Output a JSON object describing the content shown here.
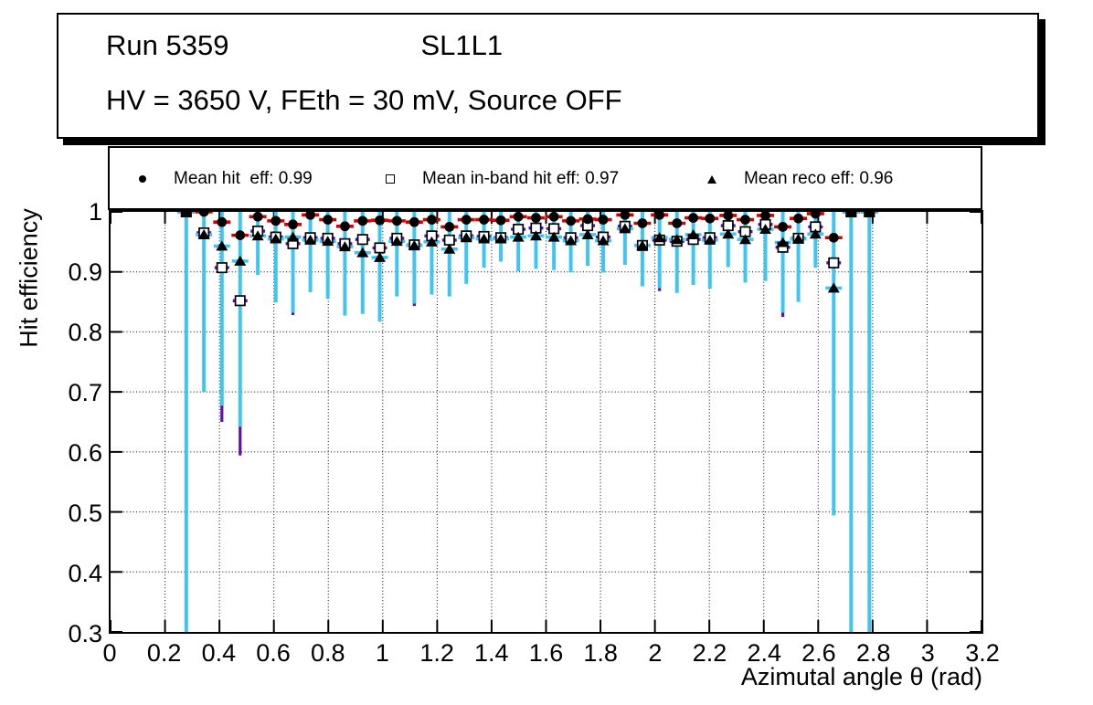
{
  "title_box": {
    "line1_left": "Run 5359",
    "line1_right": "SL1L1",
    "line2": "HV = 3650 V, FEth = 30 mV, Source OFF"
  },
  "legend": {
    "entries": [
      {
        "marker": "filled-circle",
        "label": "Mean hit  eff: 0.99"
      },
      {
        "marker": "open-square",
        "label": "Mean in-band hit eff: 0.97"
      },
      {
        "marker": "filled-triangle",
        "label": "Mean reco eff: 0.96"
      }
    ]
  },
  "chart_data": {
    "type": "scatter",
    "xlabel": "Azimutal angle θ (rad)",
    "ylabel": "Hit efficiency",
    "xlim": [
      0,
      3.2
    ],
    "ylim": [
      0.3,
      1.0
    ],
    "grid": "dotted-both",
    "legend_position": "top-band",
    "x_tick_values": [
      0,
      0.2,
      0.4,
      0.6,
      0.8,
      1,
      1.2,
      1.4,
      1.6,
      1.8,
      2,
      2.2,
      2.4,
      2.6,
      2.8,
      3,
      3.2
    ],
    "x_tick_labels": [
      "0",
      "0.2",
      "0.4",
      "0.6",
      "0.8",
      "1",
      "1.2",
      "1.4",
      "1.6",
      "1.8",
      "2",
      "2.2",
      "2.4",
      "2.6",
      "2.8",
      "3",
      "3.2"
    ],
    "y_tick_values": [
      0.3,
      0.4,
      0.5,
      0.6,
      0.7,
      0.8,
      0.9,
      1
    ],
    "y_tick_labels": [
      "0.3",
      "0.4",
      "0.5",
      "0.6",
      "0.7",
      "0.8",
      "0.9",
      "1"
    ],
    "colors": {
      "marker": "#000000",
      "hit_xerr": "#d40000",
      "inband_err": "#5c10b2",
      "reco_err": "#3fc6f0"
    },
    "series": [
      {
        "name": "Mean hit  eff: 0.99",
        "mean": 0.99,
        "marker": "filled-circle",
        "value_key": "hit"
      },
      {
        "name": "Mean in-band hit eff: 0.97",
        "mean": 0.97,
        "marker": "open-square",
        "value_key": "inband"
      },
      {
        "name": "Mean reco eff: 0.96",
        "mean": 0.96,
        "marker": "filled-triangle",
        "value_key": "reco"
      }
    ],
    "points": [
      {
        "x": 0.278,
        "hit": 1.0,
        "inband": 1.0,
        "reco": 1.0,
        "reco_lo": 0.3
      },
      {
        "x": 0.343,
        "hit": 1.0,
        "inband": 0.965,
        "reco": 0.962,
        "reco_lo": 0.7
      },
      {
        "x": 0.409,
        "hit": 0.983,
        "inband": 0.907,
        "reco": 0.943,
        "reco_lo": 0.677,
        "inband_lo": 0.65
      },
      {
        "x": 0.476,
        "hit": 0.961,
        "inband": 0.852,
        "reco": 0.918,
        "reco_lo": 0.642,
        "inband_lo": 0.594
      },
      {
        "x": 0.541,
        "hit": 0.992,
        "inband": 0.968,
        "reco": 0.96,
        "reco_lo": 0.895
      },
      {
        "x": 0.607,
        "hit": 0.985,
        "inband": 0.958,
        "reco": 0.955,
        "reco_lo": 0.849
      },
      {
        "x": 0.67,
        "hit": 0.979,
        "inband": 0.947,
        "reco": 0.958,
        "reco_lo": 0.832,
        "inband_lo": 0.828
      },
      {
        "x": 0.734,
        "hit": 0.995,
        "inband": 0.957,
        "reco": 0.953,
        "reco_lo": 0.866
      },
      {
        "x": 0.798,
        "hit": 0.987,
        "inband": 0.956,
        "reco": 0.951,
        "reco_lo": 0.855
      },
      {
        "x": 0.861,
        "hit": 0.976,
        "inband": 0.947,
        "reco": 0.942,
        "reco_lo": 0.827
      },
      {
        "x": 0.926,
        "hit": 0.985,
        "inband": 0.954,
        "reco": 0.932,
        "reco_lo": 0.83
      },
      {
        "x": 0.989,
        "hit": 0.986,
        "inband": 0.94,
        "reco": 0.924,
        "reco_lo": 0.817
      },
      {
        "x": 1.052,
        "hit": 0.985,
        "inband": 0.956,
        "reco": 0.951,
        "reco_lo": 0.859
      },
      {
        "x": 1.116,
        "hit": 0.983,
        "inband": 0.945,
        "reco": 0.944,
        "reco_lo": 0.847,
        "inband_lo": 0.843
      },
      {
        "x": 1.18,
        "hit": 0.987,
        "inband": 0.96,
        "reco": 0.95,
        "reco_lo": 0.862
      },
      {
        "x": 1.245,
        "hit": 0.975,
        "inband": 0.953,
        "reco": 0.938,
        "reco_lo": 0.859
      },
      {
        "x": 1.307,
        "hit": 0.987,
        "inband": 0.96,
        "reco": 0.957,
        "reco_lo": 0.88
      },
      {
        "x": 1.372,
        "hit": 0.987,
        "inband": 0.959,
        "reco": 0.955,
        "reco_lo": 0.907
      },
      {
        "x": 1.434,
        "hit": 0.986,
        "inband": 0.957,
        "reco": 0.955,
        "reco_lo": 0.917
      },
      {
        "x": 1.498,
        "hit": 0.992,
        "inband": 0.971,
        "reco": 0.958,
        "reco_lo": 0.901
      },
      {
        "x": 1.563,
        "hit": 0.99,
        "inband": 0.973,
        "reco": 0.96,
        "reco_lo": 0.905
      },
      {
        "x": 1.629,
        "hit": 0.992,
        "inband": 0.972,
        "reco": 0.958,
        "reco_lo": 0.903
      },
      {
        "x": 1.691,
        "hit": 0.985,
        "inband": 0.957,
        "reco": 0.952,
        "reco_lo": 0.899
      },
      {
        "x": 1.753,
        "hit": 0.988,
        "inband": 0.977,
        "reco": 0.962,
        "reco_lo": 0.91
      },
      {
        "x": 1.81,
        "hit": 0.987,
        "inband": 0.958,
        "reco": 0.952,
        "reco_lo": 0.899
      },
      {
        "x": 1.89,
        "hit": 0.995,
        "inband": 0.976,
        "reco": 0.972,
        "reco_lo": 0.912
      },
      {
        "x": 1.954,
        "hit": 0.981,
        "inband": 0.944,
        "reco": 0.944,
        "reco_lo": 0.876
      },
      {
        "x": 2.017,
        "hit": 0.995,
        "inband": 0.953,
        "reco": 0.957,
        "reco_lo": 0.873,
        "inband_lo": 0.868
      },
      {
        "x": 2.081,
        "hit": 0.981,
        "inband": 0.951,
        "reco": 0.954,
        "reco_lo": 0.865
      },
      {
        "x": 2.141,
        "hit": 0.99,
        "inband": 0.954,
        "reco": 0.962,
        "reco_lo": 0.878
      },
      {
        "x": 2.202,
        "hit": 0.989,
        "inband": 0.957,
        "reco": 0.953,
        "reco_lo": 0.872
      },
      {
        "x": 2.269,
        "hit": 0.994,
        "inband": 0.977,
        "reco": 0.963,
        "reco_lo": 0.908
      },
      {
        "x": 2.332,
        "hit": 0.987,
        "inband": 0.967,
        "reco": 0.954,
        "reco_lo": 0.882
      },
      {
        "x": 2.406,
        "hit": 0.994,
        "inband": 0.979,
        "reco": 0.971,
        "reco_lo": 0.885
      },
      {
        "x": 2.47,
        "hit": 0.975,
        "inband": 0.941,
        "reco": 0.949,
        "reco_lo": 0.832,
        "inband_lo": 0.825
      },
      {
        "x": 2.527,
        "hit": 0.989,
        "inband": 0.956,
        "reco": 0.955,
        "reco_lo": 0.85
      },
      {
        "x": 2.59,
        "hit": 0.997,
        "inband": 0.975,
        "reco": 0.963,
        "reco_lo": 0.907
      },
      {
        "x": 2.657,
        "hit": 0.957,
        "inband": 0.915,
        "reco": 0.873,
        "reco_lo": 0.494
      },
      {
        "x": 2.721,
        "hit": 1.0,
        "inband": 1.0,
        "reco": 1.0,
        "reco_lo": 0.3
      },
      {
        "x": 2.788,
        "hit": 1.0,
        "inband": 1.0,
        "reco": 1.0,
        "reco_lo": 0.3
      }
    ]
  }
}
